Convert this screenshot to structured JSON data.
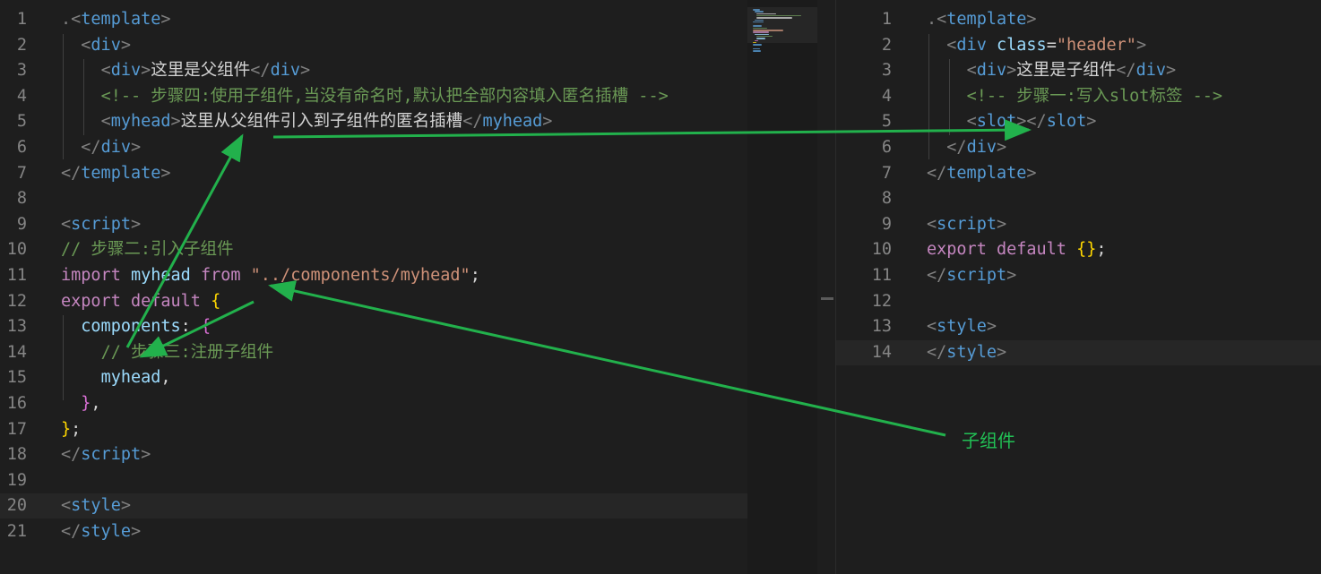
{
  "left_editor": {
    "lines": [
      {
        "n": "1",
        "parts": [
          {
            "c": "punct",
            "t": "."
          },
          {
            "c": "punct",
            "t": "<"
          },
          {
            "c": "tag",
            "t": "template"
          },
          {
            "c": "punct",
            "t": ">"
          }
        ]
      },
      {
        "n": "2",
        "parts": [
          {
            "c": "txt",
            "t": "  "
          },
          {
            "c": "punct",
            "t": "<"
          },
          {
            "c": "tag",
            "t": "div"
          },
          {
            "c": "punct",
            "t": ">"
          }
        ]
      },
      {
        "n": "3",
        "parts": [
          {
            "c": "txt",
            "t": "    "
          },
          {
            "c": "punct",
            "t": "<"
          },
          {
            "c": "tag",
            "t": "div"
          },
          {
            "c": "punct",
            "t": ">"
          },
          {
            "c": "txt",
            "t": "这里是父组件"
          },
          {
            "c": "punct",
            "t": "</"
          },
          {
            "c": "tag",
            "t": "div"
          },
          {
            "c": "punct",
            "t": ">"
          }
        ]
      },
      {
        "n": "4",
        "parts": [
          {
            "c": "txt",
            "t": "    "
          },
          {
            "c": "cmt",
            "t": "<!-- 步骤四:使用子组件,当没有命名时,默认把全部内容填入匿名插槽 -->"
          }
        ]
      },
      {
        "n": "5",
        "parts": [
          {
            "c": "txt",
            "t": "    "
          },
          {
            "c": "punct",
            "t": "<"
          },
          {
            "c": "tag",
            "t": "myhead"
          },
          {
            "c": "punct",
            "t": ">"
          },
          {
            "c": "txt",
            "t": "这里从父组件引入到子组件的匿名插槽"
          },
          {
            "c": "punct",
            "t": "</"
          },
          {
            "c": "tag",
            "t": "myhead"
          },
          {
            "c": "punct",
            "t": ">"
          }
        ]
      },
      {
        "n": "6",
        "parts": [
          {
            "c": "txt",
            "t": "  "
          },
          {
            "c": "punct",
            "t": "</"
          },
          {
            "c": "tag",
            "t": "div"
          },
          {
            "c": "punct",
            "t": ">"
          }
        ]
      },
      {
        "n": "7",
        "parts": [
          {
            "c": "punct",
            "t": "</"
          },
          {
            "c": "tag",
            "t": "template"
          },
          {
            "c": "punct",
            "t": ">"
          }
        ]
      },
      {
        "n": "8",
        "parts": []
      },
      {
        "n": "9",
        "parts": [
          {
            "c": "punct",
            "t": "<"
          },
          {
            "c": "tag",
            "t": "script"
          },
          {
            "c": "punct",
            "t": ">"
          }
        ]
      },
      {
        "n": "10",
        "parts": [
          {
            "c": "cmt",
            "t": "// 步骤二:引入子组件"
          }
        ]
      },
      {
        "n": "11",
        "parts": [
          {
            "c": "kw",
            "t": "import"
          },
          {
            "c": "txt",
            "t": " "
          },
          {
            "c": "var",
            "t": "myhead"
          },
          {
            "c": "txt",
            "t": " "
          },
          {
            "c": "kw",
            "t": "from"
          },
          {
            "c": "txt",
            "t": " "
          },
          {
            "c": "str",
            "t": "\"../components/myhead\""
          },
          {
            "c": "txt",
            "t": ";"
          }
        ]
      },
      {
        "n": "12",
        "parts": [
          {
            "c": "kw",
            "t": "export"
          },
          {
            "c": "txt",
            "t": " "
          },
          {
            "c": "kw",
            "t": "default"
          },
          {
            "c": "txt",
            "t": " "
          },
          {
            "c": "brace1",
            "t": "{"
          }
        ]
      },
      {
        "n": "13",
        "parts": [
          {
            "c": "txt",
            "t": "  "
          },
          {
            "c": "var",
            "t": "components"
          },
          {
            "c": "txt",
            "t": ": "
          },
          {
            "c": "brace2",
            "t": "{"
          }
        ]
      },
      {
        "n": "14",
        "parts": [
          {
            "c": "txt",
            "t": "    "
          },
          {
            "c": "cmt",
            "t": "// 步骤三:注册子组件"
          }
        ]
      },
      {
        "n": "15",
        "parts": [
          {
            "c": "txt",
            "t": "    "
          },
          {
            "c": "var",
            "t": "myhead"
          },
          {
            "c": "txt",
            "t": ","
          }
        ]
      },
      {
        "n": "16",
        "parts": [
          {
            "c": "txt",
            "t": "  "
          },
          {
            "c": "brace2",
            "t": "}"
          },
          {
            "c": "txt",
            "t": ","
          }
        ]
      },
      {
        "n": "17",
        "parts": [
          {
            "c": "brace1",
            "t": "}"
          },
          {
            "c": "txt",
            "t": ";"
          }
        ]
      },
      {
        "n": "18",
        "parts": [
          {
            "c": "punct",
            "t": "</"
          },
          {
            "c": "tag",
            "t": "script"
          },
          {
            "c": "punct",
            "t": ">"
          }
        ]
      },
      {
        "n": "19",
        "parts": []
      },
      {
        "n": "20",
        "parts": [
          {
            "c": "punct",
            "t": "<"
          },
          {
            "c": "tag",
            "t": "style"
          },
          {
            "c": "punct",
            "t": ">"
          }
        ]
      },
      {
        "n": "21",
        "parts": [
          {
            "c": "punct",
            "t": "</"
          },
          {
            "c": "tag",
            "t": "style"
          },
          {
            "c": "punct",
            "t": ">"
          }
        ]
      }
    ]
  },
  "right_editor": {
    "lines": [
      {
        "n": "1",
        "parts": [
          {
            "c": "punct",
            "t": "."
          },
          {
            "c": "punct",
            "t": "<"
          },
          {
            "c": "tag",
            "t": "template"
          },
          {
            "c": "punct",
            "t": ">"
          }
        ]
      },
      {
        "n": "2",
        "parts": [
          {
            "c": "txt",
            "t": "  "
          },
          {
            "c": "punct",
            "t": "<"
          },
          {
            "c": "tag",
            "t": "div"
          },
          {
            "c": "txt",
            "t": " "
          },
          {
            "c": "attr",
            "t": "class"
          },
          {
            "c": "txt",
            "t": "="
          },
          {
            "c": "str",
            "t": "\"header\""
          },
          {
            "c": "punct",
            "t": ">"
          }
        ]
      },
      {
        "n": "3",
        "parts": [
          {
            "c": "txt",
            "t": "    "
          },
          {
            "c": "punct",
            "t": "<"
          },
          {
            "c": "tag",
            "t": "div"
          },
          {
            "c": "punct",
            "t": ">"
          },
          {
            "c": "txt",
            "t": "这里是子组件"
          },
          {
            "c": "punct",
            "t": "</"
          },
          {
            "c": "tag",
            "t": "div"
          },
          {
            "c": "punct",
            "t": ">"
          }
        ]
      },
      {
        "n": "4",
        "parts": [
          {
            "c": "txt",
            "t": "    "
          },
          {
            "c": "cmt",
            "t": "<!-- 步骤一:写入slot标签 -->"
          }
        ]
      },
      {
        "n": "5",
        "parts": [
          {
            "c": "txt",
            "t": "    "
          },
          {
            "c": "punct",
            "t": "<"
          },
          {
            "c": "tag",
            "t": "slot"
          },
          {
            "c": "punct",
            "t": ">"
          },
          {
            "c": "punct",
            "t": "</"
          },
          {
            "c": "tag",
            "t": "slot"
          },
          {
            "c": "punct",
            "t": ">"
          }
        ]
      },
      {
        "n": "6",
        "parts": [
          {
            "c": "txt",
            "t": "  "
          },
          {
            "c": "punct",
            "t": "</"
          },
          {
            "c": "tag",
            "t": "div"
          },
          {
            "c": "punct",
            "t": ">"
          }
        ]
      },
      {
        "n": "7",
        "parts": [
          {
            "c": "punct",
            "t": "</"
          },
          {
            "c": "tag",
            "t": "template"
          },
          {
            "c": "punct",
            "t": ">"
          }
        ]
      },
      {
        "n": "8",
        "parts": []
      },
      {
        "n": "9",
        "parts": [
          {
            "c": "punct",
            "t": "<"
          },
          {
            "c": "tag",
            "t": "script"
          },
          {
            "c": "punct",
            "t": ">"
          }
        ]
      },
      {
        "n": "10",
        "parts": [
          {
            "c": "kw",
            "t": "export"
          },
          {
            "c": "txt",
            "t": " "
          },
          {
            "c": "kw",
            "t": "default"
          },
          {
            "c": "txt",
            "t": " "
          },
          {
            "c": "brace1",
            "t": "{}"
          },
          {
            "c": "txt",
            "t": ";"
          }
        ]
      },
      {
        "n": "11",
        "parts": [
          {
            "c": "punct",
            "t": "</"
          },
          {
            "c": "tag",
            "t": "script"
          },
          {
            "c": "punct",
            "t": ">"
          }
        ]
      },
      {
        "n": "12",
        "parts": []
      },
      {
        "n": "13",
        "parts": [
          {
            "c": "punct",
            "t": "<"
          },
          {
            "c": "tag",
            "t": "style"
          },
          {
            "c": "punct",
            "t": ">"
          }
        ]
      },
      {
        "n": "14",
        "parts": [
          {
            "c": "punct",
            "t": "</"
          },
          {
            "c": "tag",
            "t": "style"
          },
          {
            "c": "punct",
            "t": ">"
          }
        ]
      }
    ]
  },
  "annotation": {
    "label": "子组件",
    "color": "#22c055"
  },
  "colors": {
    "background": "#1e1e1e",
    "arrow": "#22b14c"
  }
}
